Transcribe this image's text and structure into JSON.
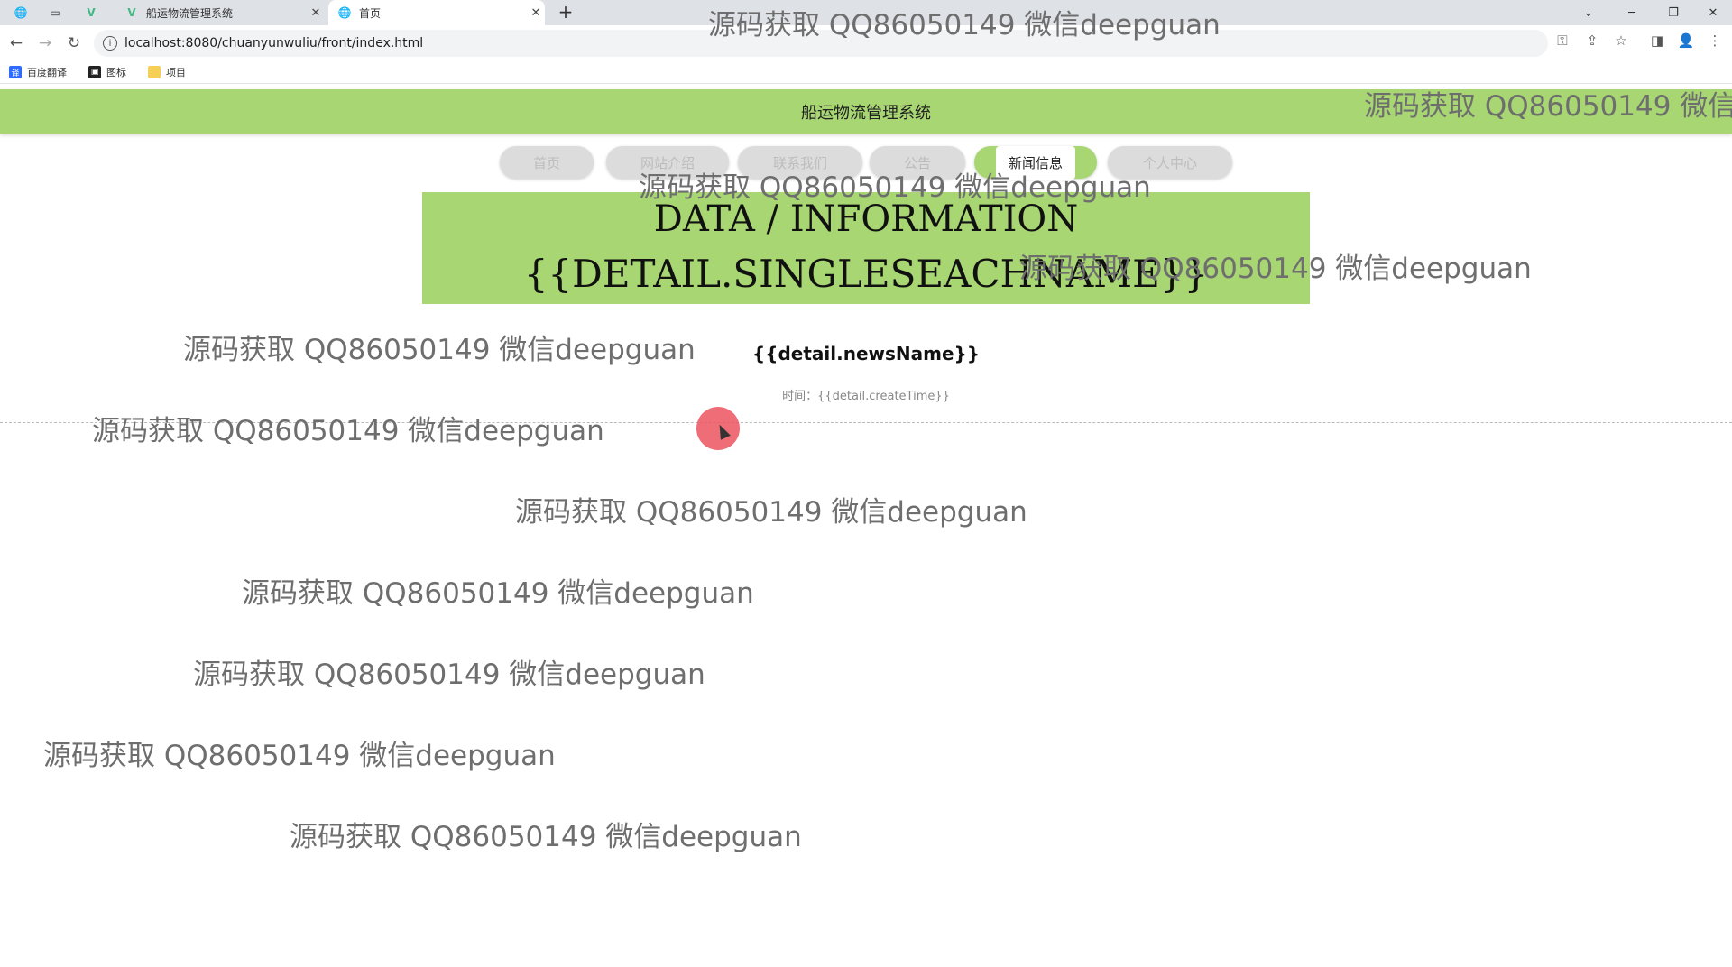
{
  "browser": {
    "tabs": [
      {
        "title": "船运物流管理系统",
        "active": false
      },
      {
        "title": "首页",
        "active": true
      }
    ],
    "new_tab_symbol": "+",
    "url": "localhost:8080/chuanyunwuliu/front/index.html",
    "bookmarks": [
      {
        "label": "百度翻译",
        "icon": "translate-icon"
      },
      {
        "label": "图标",
        "icon": "image-icon"
      },
      {
        "label": "项目",
        "icon": "folder-icon"
      }
    ]
  },
  "site": {
    "system_name": "船运物流管理系统",
    "nav": [
      {
        "label": "首页",
        "active": false
      },
      {
        "label": "网站介绍",
        "active": false
      },
      {
        "label": "联系我们",
        "active": false
      },
      {
        "label": "公告",
        "active": false
      },
      {
        "label": "新闻信息",
        "active": true
      },
      {
        "label": "个人中心",
        "active": false
      }
    ],
    "banner_line1": "DATA / INFORMATION",
    "banner_line2": "{{DETAIL.SINGLESEACHNAME}}",
    "news_title": "{{detail.newsName}}",
    "time_label": "时间：",
    "time_value": "{{detail.createTime}}"
  },
  "watermark_text": "源码获取 QQ86050149 微信deepguan",
  "watermark_text_cut": "源码获取 QQ86050149 微信d",
  "colors": {
    "accent_green": "#a7d673",
    "cursor_highlight": "#ec545e"
  }
}
